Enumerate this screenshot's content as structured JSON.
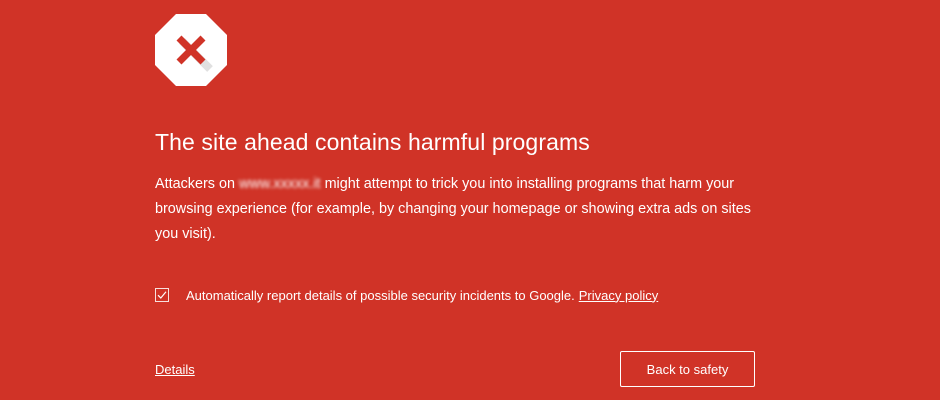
{
  "warning": {
    "icon": "stop-x-icon",
    "title": "The site ahead contains harmful programs",
    "body_prefix": "Attackers on",
    "blurred_url": "www.xxxxx.it",
    "body_suffix": "might attempt to trick you into installing programs that harm your browsing experience (for example, by changing your homepage or showing extra ads on sites you visit)."
  },
  "report": {
    "checked": true,
    "text": "Automatically report details of possible security incidents to Google.",
    "privacy_link": "Privacy policy"
  },
  "footer": {
    "details_link": "Details",
    "back_button": "Back to safety"
  },
  "colors": {
    "background": "#d03327",
    "icon_fill": "#ffffff",
    "icon_x": "#d03327",
    "text": "#ffffff"
  }
}
